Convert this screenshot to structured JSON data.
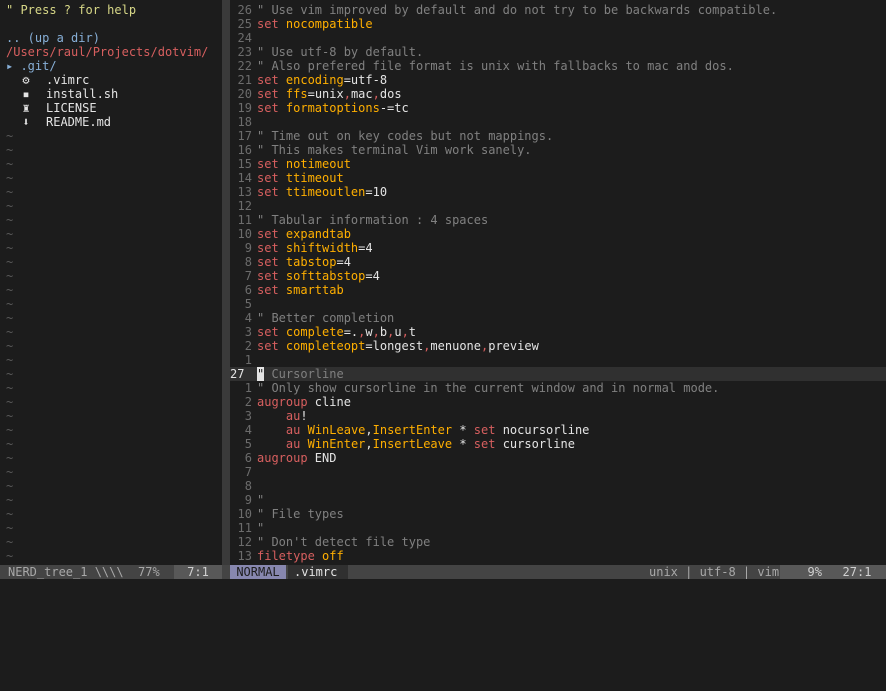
{
  "tree": {
    "help": "\" Press ? for help",
    "updir": ".. (up a dir)",
    "root": "/Users/raul/Projects/dotvim/",
    "git_dir": "▸ .git/",
    "files": [
      {
        "icon": "⚙",
        "name": ".vimrc",
        "icon_name": "gear-icon"
      },
      {
        "icon": "▪",
        "name": "install.sh",
        "icon_name": "square-icon"
      },
      {
        "icon": "♜",
        "name": "LICENSE",
        "icon_name": "license-icon"
      },
      {
        "icon": "⬇",
        "name": "README.md",
        "icon_name": "down-arrow-icon"
      }
    ],
    "tilde": "~"
  },
  "editor": {
    "lines": [
      {
        "n": "26",
        "segs": [
          [
            "cmt",
            "\" Use vim improved by default and do not try to be backwards compatible."
          ]
        ]
      },
      {
        "n": "25",
        "segs": [
          [
            "kw",
            "set "
          ],
          [
            "opt",
            "nocompatible"
          ]
        ]
      },
      {
        "n": "24",
        "segs": []
      },
      {
        "n": "23",
        "segs": [
          [
            "cmt",
            "\" Use utf-8 by default."
          ]
        ]
      },
      {
        "n": "22",
        "segs": [
          [
            "cmt",
            "\" Also prefered file format is unix with fallbacks to mac and dos."
          ]
        ]
      },
      {
        "n": "21",
        "segs": [
          [
            "kw",
            "set "
          ],
          [
            "opt",
            "encoding"
          ],
          [
            "txt",
            "=utf-8"
          ]
        ]
      },
      {
        "n": "20",
        "segs": [
          [
            "kw",
            "set "
          ],
          [
            "opt",
            "ffs"
          ],
          [
            "txt",
            "=unix"
          ],
          [
            "kw",
            ","
          ],
          [
            "txt",
            "mac"
          ],
          [
            "kw",
            ","
          ],
          [
            "txt",
            "dos"
          ]
        ]
      },
      {
        "n": "19",
        "segs": [
          [
            "kw",
            "set "
          ],
          [
            "opt",
            "formatoptions"
          ],
          [
            "txt",
            "-=tc"
          ]
        ]
      },
      {
        "n": "18",
        "segs": []
      },
      {
        "n": "17",
        "segs": [
          [
            "cmt",
            "\" Time out on key codes but not mappings."
          ]
        ]
      },
      {
        "n": "16",
        "segs": [
          [
            "cmt",
            "\" This makes terminal Vim work sanely."
          ]
        ]
      },
      {
        "n": "15",
        "segs": [
          [
            "kw",
            "set "
          ],
          [
            "opt",
            "notimeout"
          ]
        ]
      },
      {
        "n": "14",
        "segs": [
          [
            "kw",
            "set "
          ],
          [
            "opt",
            "ttimeout"
          ]
        ]
      },
      {
        "n": "13",
        "segs": [
          [
            "kw",
            "set "
          ],
          [
            "opt",
            "ttimeoutlen"
          ],
          [
            "txt",
            "=10"
          ]
        ]
      },
      {
        "n": "12",
        "segs": []
      },
      {
        "n": "11",
        "segs": [
          [
            "cmt",
            "\" Tabular information : 4 spaces"
          ]
        ]
      },
      {
        "n": "10",
        "segs": [
          [
            "kw",
            "set "
          ],
          [
            "opt",
            "expandtab"
          ]
        ]
      },
      {
        "n": "9",
        "segs": [
          [
            "kw",
            "set "
          ],
          [
            "opt",
            "shiftwidth"
          ],
          [
            "txt",
            "=4"
          ]
        ]
      },
      {
        "n": "8",
        "segs": [
          [
            "kw",
            "set "
          ],
          [
            "opt",
            "tabstop"
          ],
          [
            "txt",
            "=4"
          ]
        ]
      },
      {
        "n": "7",
        "segs": [
          [
            "kw",
            "set "
          ],
          [
            "opt",
            "softtabstop"
          ],
          [
            "txt",
            "=4"
          ]
        ]
      },
      {
        "n": "6",
        "segs": [
          [
            "kw",
            "set "
          ],
          [
            "opt",
            "smarttab"
          ]
        ]
      },
      {
        "n": "5",
        "segs": []
      },
      {
        "n": "4",
        "segs": [
          [
            "cmt",
            "\" Better completion"
          ]
        ]
      },
      {
        "n": "3",
        "segs": [
          [
            "kw",
            "set "
          ],
          [
            "opt",
            "complete"
          ],
          [
            "txt",
            "=."
          ],
          [
            "kw",
            ","
          ],
          [
            "txt",
            "w"
          ],
          [
            "kw",
            ","
          ],
          [
            "txt",
            "b"
          ],
          [
            "kw",
            ","
          ],
          [
            "txt",
            "u"
          ],
          [
            "kw",
            ","
          ],
          [
            "txt",
            "t"
          ]
        ]
      },
      {
        "n": "2",
        "segs": [
          [
            "kw",
            "set "
          ],
          [
            "opt",
            "completeopt"
          ],
          [
            "txt",
            "=longest"
          ],
          [
            "kw",
            ","
          ],
          [
            "txt",
            "menuone"
          ],
          [
            "kw",
            ","
          ],
          [
            "txt",
            "preview"
          ]
        ]
      },
      {
        "n": "1",
        "segs": []
      },
      {
        "n": "27",
        "cur": true,
        "segs": [
          [
            "cursor",
            "\""
          ],
          [
            "cmt",
            " Cursorline"
          ]
        ]
      },
      {
        "n": "1",
        "segs": [
          [
            "cmt",
            "\" Only show cursorline in the current window and in normal mode."
          ]
        ]
      },
      {
        "n": "2",
        "segs": [
          [
            "kw",
            "augroup "
          ],
          [
            "txt",
            "cline"
          ]
        ]
      },
      {
        "n": "3",
        "segs": [
          [
            "txt",
            "    "
          ],
          [
            "kw",
            "au"
          ],
          [
            "txt",
            "!"
          ]
        ]
      },
      {
        "n": "4",
        "segs": [
          [
            "txt",
            "    "
          ],
          [
            "kw",
            "au "
          ],
          [
            "opt",
            "WinLeave"
          ],
          [
            "txt",
            ","
          ],
          [
            "opt",
            "InsertEnter"
          ],
          [
            "txt",
            " * "
          ],
          [
            "kw",
            "set "
          ],
          [
            "txt",
            "nocursorline"
          ]
        ]
      },
      {
        "n": "5",
        "segs": [
          [
            "txt",
            "    "
          ],
          [
            "kw",
            "au "
          ],
          [
            "opt",
            "WinEnter"
          ],
          [
            "txt",
            ","
          ],
          [
            "opt",
            "InsertLeave"
          ],
          [
            "txt",
            " * "
          ],
          [
            "kw",
            "set "
          ],
          [
            "txt",
            "cursorline"
          ]
        ]
      },
      {
        "n": "6",
        "segs": [
          [
            "kw",
            "augroup "
          ],
          [
            "txt",
            "END"
          ]
        ]
      },
      {
        "n": "7",
        "segs": []
      },
      {
        "n": "8",
        "segs": []
      },
      {
        "n": "9",
        "segs": [
          [
            "cmt",
            "\""
          ]
        ]
      },
      {
        "n": "10",
        "segs": [
          [
            "cmt",
            "\" File types"
          ]
        ]
      },
      {
        "n": "11",
        "segs": [
          [
            "cmt",
            "\""
          ]
        ]
      },
      {
        "n": "12",
        "segs": [
          [
            "cmt",
            "\" Don't detect file type"
          ]
        ]
      },
      {
        "n": "13",
        "segs": [
          [
            "kw",
            "filetype "
          ],
          [
            "opt",
            "off"
          ]
        ]
      }
    ]
  },
  "status": {
    "tree_name": "NERD_tree_1 \\\\\\\\",
    "tree_percent": "77%",
    "tree_pos": "7:1",
    "mode": "NORMAL",
    "filename": ".vimrc",
    "fileinfo": "unix | utf-8 | vim",
    "percent": "9%",
    "position": "27:1"
  },
  "colors": {
    "background": "#1c1c1c",
    "keyword": "#d75f5f",
    "option": "#ffaf00",
    "comment": "#808080",
    "mode_bg": "#8787af"
  }
}
